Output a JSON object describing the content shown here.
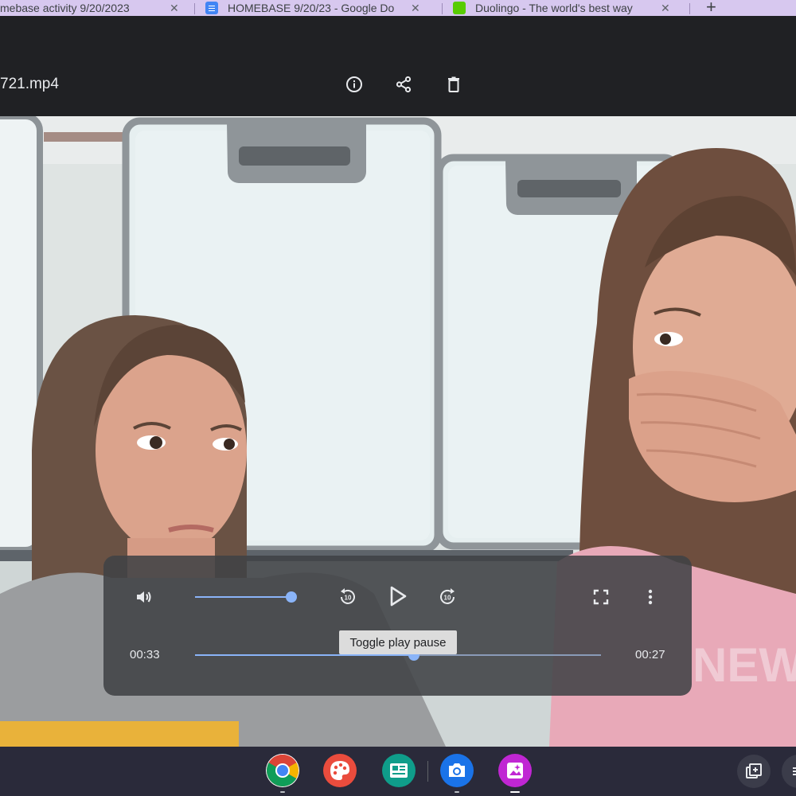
{
  "browser_tabs": [
    {
      "title": "mebase activity 9/20/2023",
      "icon": "generic-tab-icon"
    },
    {
      "title": "HOMEBASE 9/20/23 - Google Do",
      "icon": "google-docs-icon"
    },
    {
      "title": "Duolingo - The world's best way",
      "icon": "duolingo-icon"
    }
  ],
  "tab_close_glyph": "✕",
  "new_tab_glyph": "+",
  "viewer": {
    "filename": "721.mp4",
    "header_buttons": [
      "info-icon",
      "share-icon",
      "delete-icon"
    ]
  },
  "player": {
    "current_time": "00:33",
    "remaining_time": "00:27",
    "volume_fraction": 0.8,
    "progress_fraction": 0.54,
    "tooltip": "Toggle play pause",
    "buttons": [
      "volume-icon",
      "replay-10-icon",
      "play-icon",
      "forward-10-icon",
      "fullscreen-icon",
      "more-vert-icon"
    ],
    "skip_seconds": "10"
  },
  "shelf": {
    "apps": [
      "chrome-icon",
      "canvas-paint-icon",
      "classroom-news-icon",
      "camera-icon",
      "gallery-icon"
    ],
    "tray_buttons": [
      "screen-capture-icon",
      "tray-menu-icon"
    ]
  },
  "colors": {
    "accent": "#8ab4f8",
    "tab_strip": "#d7c8ef",
    "header": "#202124",
    "shelf": "#2a2a3a"
  }
}
